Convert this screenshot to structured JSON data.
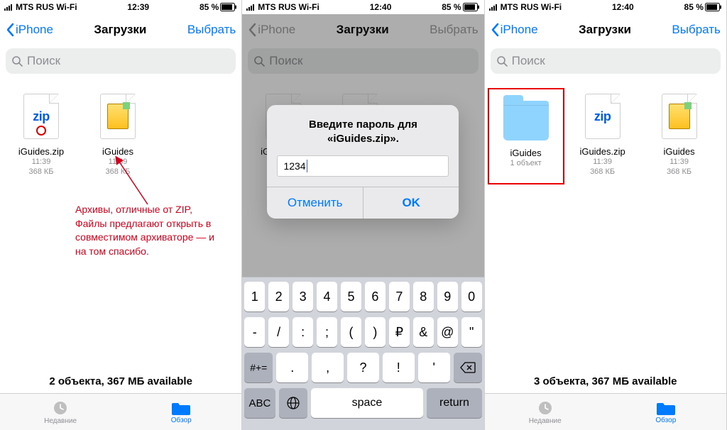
{
  "status": {
    "carrier": "MTS RUS Wi-Fi",
    "battery": "85 %"
  },
  "times": {
    "s1": "12:39",
    "s2": "12:40",
    "s3": "12:40"
  },
  "nav": {
    "back": "iPhone",
    "title": "Загрузки",
    "select": "Выбрать"
  },
  "search": {
    "placeholder": "Поиск"
  },
  "files": {
    "zip": {
      "name": "iGuides.zip",
      "time": "11:39",
      "size": "368 КБ",
      "zipBadge": "zip"
    },
    "rar": {
      "name": "iGuides",
      "time": "11:39",
      "size": "368 КБ"
    },
    "folder": {
      "name": "iGuides",
      "meta": "1 объект"
    }
  },
  "annotation": "Архивы, отличные от ZIP, Файлы предлагают открыть в совместимом архиваторе — и на том спасибо.",
  "footer": {
    "s1": "2 объекта, 367 МБ available",
    "s3": "3 объекта, 367 МБ available"
  },
  "tabs": {
    "recent": "Недавние",
    "browse": "Обзор"
  },
  "alert": {
    "title": "Введите пароль для «iGuides.zip».",
    "value": "1234",
    "cancel": "Отменить",
    "ok": "OK"
  },
  "keyboard": {
    "row1": [
      "1",
      "2",
      "3",
      "4",
      "5",
      "6",
      "7",
      "8",
      "9",
      "0"
    ],
    "row2": [
      "-",
      "/",
      ":",
      ";",
      "(",
      ")",
      "₽",
      "&",
      "@",
      "\""
    ],
    "row3_shift": "#+=",
    "row3": [
      ".",
      ",",
      "?",
      "!",
      "'"
    ],
    "abc": "ABC",
    "space": "space",
    "return": "return"
  }
}
